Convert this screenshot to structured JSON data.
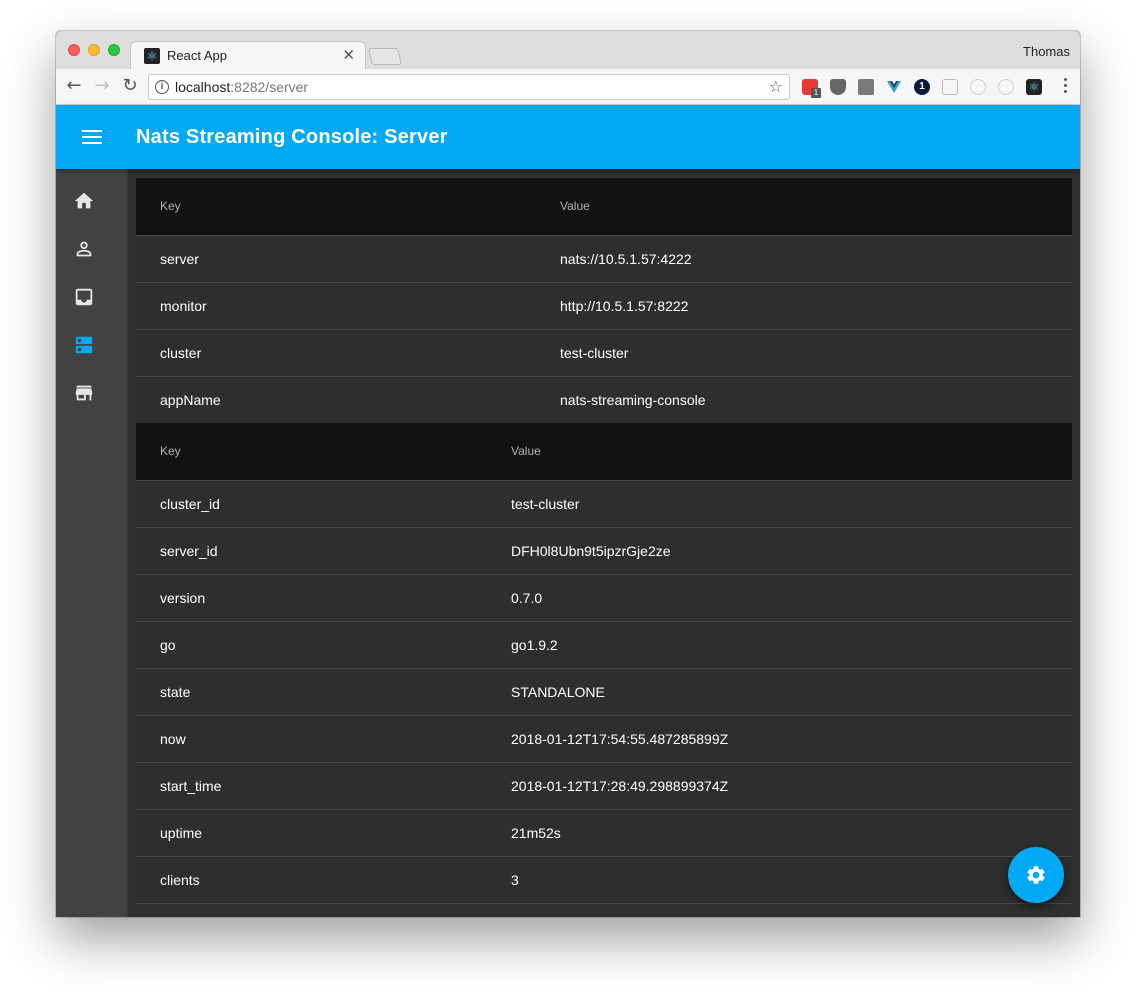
{
  "browser": {
    "tab_title": "React App",
    "profile_name": "Thomas",
    "url_host": "localhost",
    "url_rest": ":8282/server",
    "badge_count": "1",
    "ext_count": "1"
  },
  "app": {
    "title": "Nats Streaming Console: Server",
    "accent_color": "#03a9f4"
  },
  "drawer": {
    "items": [
      {
        "icon": "home-icon",
        "active": false
      },
      {
        "icon": "person-icon",
        "active": false
      },
      {
        "icon": "inbox-icon",
        "active": false
      },
      {
        "icon": "dns-icon",
        "active": true
      },
      {
        "icon": "store-icon",
        "active": false
      }
    ]
  },
  "config_table": {
    "headers": [
      "Key",
      "Value"
    ],
    "rows": [
      {
        "key": "server",
        "value": "nats://10.5.1.57:4222"
      },
      {
        "key": "monitor",
        "value": "http://10.5.1.57:8222"
      },
      {
        "key": "cluster",
        "value": "test-cluster"
      },
      {
        "key": "appName",
        "value": "nats-streaming-console"
      }
    ]
  },
  "server_table": {
    "headers": [
      "Key",
      "Value"
    ],
    "rows": [
      {
        "key": "cluster_id",
        "value": "test-cluster"
      },
      {
        "key": "server_id",
        "value": "DFH0l8Ubn9t5ipzrGje2ze"
      },
      {
        "key": "version",
        "value": "0.7.0"
      },
      {
        "key": "go",
        "value": "go1.9.2"
      },
      {
        "key": "state",
        "value": "STANDALONE"
      },
      {
        "key": "now",
        "value": "2018-01-12T17:54:55.487285899Z"
      },
      {
        "key": "start_time",
        "value": "2018-01-12T17:28:49.298899374Z"
      },
      {
        "key": "uptime",
        "value": "21m52s"
      },
      {
        "key": "clients",
        "value": "3"
      }
    ]
  },
  "fab": {
    "icon": "settings-icon"
  }
}
